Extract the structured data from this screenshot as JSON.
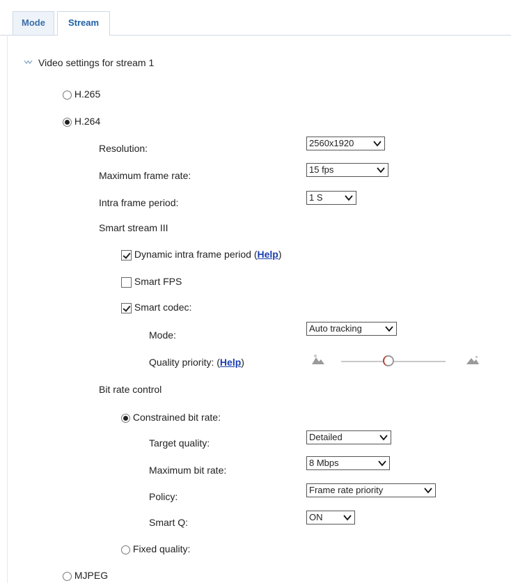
{
  "tabs": [
    {
      "label": "Mode"
    },
    {
      "label": "Stream"
    }
  ],
  "section": {
    "title": "Video settings for stream 1"
  },
  "codecs": {
    "h265": "H.265",
    "h264": "H.264",
    "mjpeg": "MJPEG"
  },
  "h264": {
    "resolution": {
      "label": "Resolution:",
      "value": "2560x1920"
    },
    "max_frame_rate": {
      "label": "Maximum frame rate:",
      "value": "15 fps"
    },
    "intra_frame_period": {
      "label": "Intra frame period:",
      "value": "1 S"
    },
    "smart_stream": {
      "title": "Smart stream III",
      "dynamic_intra": {
        "label": "Dynamic intra frame period (",
        "help": "Help",
        "close": ")",
        "checked": true
      },
      "smart_fps": {
        "label": "Smart FPS",
        "checked": false
      },
      "smart_codec": {
        "label": "Smart codec:",
        "checked": true
      },
      "mode": {
        "label": "Mode:",
        "value": "Auto tracking"
      },
      "quality_priority": {
        "label": "Quality priority: (",
        "help": "Help",
        "close": ")",
        "level": 0.45
      }
    },
    "bit_rate": {
      "title": "Bit rate control",
      "constrained": {
        "label": "Constrained bit rate:",
        "checked": true
      },
      "target_quality": {
        "label": "Target quality:",
        "value": "Detailed"
      },
      "max_bit_rate": {
        "label": "Maximum bit rate:",
        "value": "8 Mbps"
      },
      "policy": {
        "label": "Policy:",
        "value": "Frame rate priority"
      },
      "smart_q": {
        "label": "Smart Q:",
        "value": "ON"
      },
      "fixed": {
        "label": "Fixed quality:",
        "checked": false
      }
    }
  },
  "colors": {
    "accent": "#1f5fa6",
    "link": "#1a3fb0",
    "slider_knob": "#c0392b"
  }
}
